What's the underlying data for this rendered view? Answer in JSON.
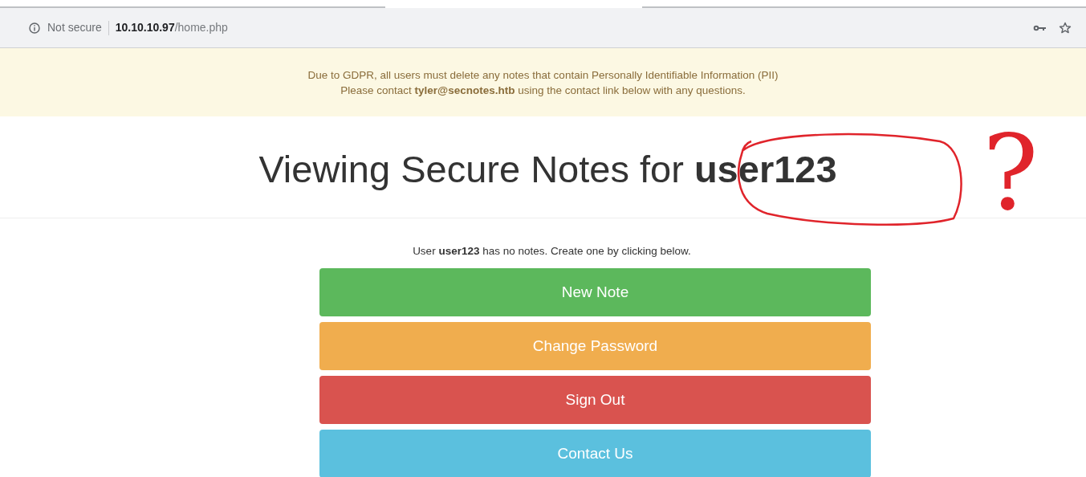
{
  "address_bar": {
    "security": "Not secure",
    "host": "10.10.10.97",
    "path": "/home.php"
  },
  "alert": {
    "lines": [
      "Due to GDPR, all users must delete any notes that contain Personally Identifiable Information (PII)",
      "Please contact **tyler@secnotes.htb** using the contact link below with any questions."
    ]
  },
  "heading": "Viewing Secure Notes for **user123**",
  "message": "User **user123** has no notes. Create one by clicking below.",
  "buttons": [
    {
      "label": "New Note",
      "kind": "success"
    },
    {
      "label": "Change Password",
      "kind": "warning"
    },
    {
      "label": "Sign Out",
      "kind": "danger"
    },
    {
      "label": "Contact Us",
      "kind": "info"
    }
  ],
  "annotation": {
    "mark": "?"
  }
}
